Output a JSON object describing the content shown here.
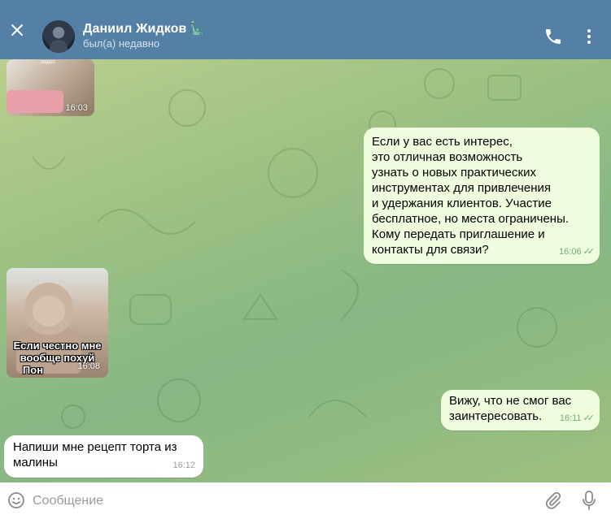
{
  "header": {
    "name": "Даниил Жидков",
    "status": "был(а) недавно"
  },
  "messages": {
    "sticker_top": {
      "label": "сюдоо",
      "time": "16:03"
    },
    "outgoing_offer": {
      "lines": [
        "Если у вас есть интерес,",
        "это отличная возможность",
        "узнать о новых практических",
        "инструментах для привлечения",
        "и удержания клиентов. Участие",
        "бесплатное, но места ограничены.",
        "Кому передать приглашение и",
        "контакты для связи?"
      ],
      "time": "16:06"
    },
    "sticker_monkey": {
      "caption": [
        "Если честно мне",
        "вообще похуй",
        "Пон"
      ],
      "time": "16:08"
    },
    "outgoing_reply": {
      "lines": [
        "Вижу, что не смог вас",
        "заинтересовать."
      ],
      "time": "16:11"
    },
    "incoming_recipe": {
      "lines": [
        "Напиши мне рецепт торта из",
        "малины"
      ],
      "time": "16:12"
    }
  },
  "input": {
    "placeholder": "Сообщение"
  },
  "colors": {
    "header": "#5580a6",
    "outgoing_bubble": "#effdde",
    "incoming_bubble": "#ffffff",
    "tick": "#6fae6a"
  }
}
